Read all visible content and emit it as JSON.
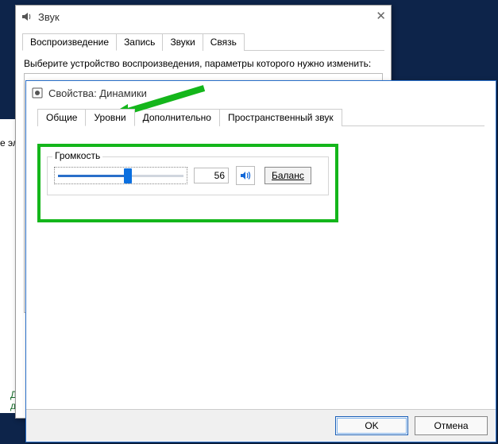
{
  "sound_window": {
    "title": "Звук",
    "close_glyph": "✕",
    "tabs": [
      "Воспроизведение",
      "Запись",
      "Звуки",
      "Связь"
    ],
    "instruction": "Выберите устройство воспроизведения, параметры которого нужно изменить:"
  },
  "props_window": {
    "title": "Свойства: Динамики",
    "tabs": [
      "Общие",
      "Уровни",
      "Дополнительно",
      "Пространственный звук"
    ],
    "active_tab_index": 1,
    "volume_group_label": "Громкость",
    "volume_value": "56",
    "balance_label": "Баланс",
    "ok_label": "OK",
    "cancel_label": "Отмена"
  },
  "sidebar_fragment": {
    "line1": "Диспе",
    "line2": "данны"
  },
  "cutoff1": "е эл"
}
